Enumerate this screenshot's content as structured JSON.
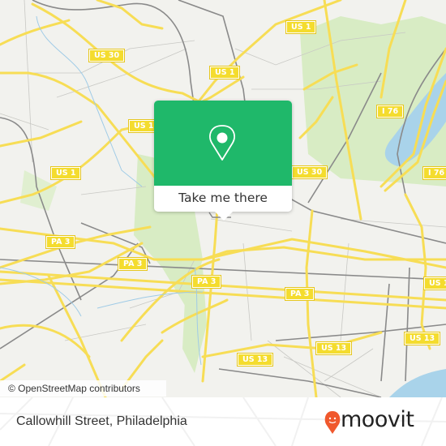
{
  "map": {
    "attribution": "© OpenStreetMap contributors",
    "route_shields": [
      {
        "label": "US 1",
        "id": "us1-top"
      },
      {
        "label": "US 30",
        "id": "us30-nw"
      },
      {
        "label": "US 1",
        "id": "us1-center"
      },
      {
        "label": "US 1",
        "id": "us1-mid"
      },
      {
        "label": "US 1",
        "id": "us1-west"
      },
      {
        "label": "US 30",
        "id": "us30-east"
      },
      {
        "label": "I 76",
        "id": "i76-north"
      },
      {
        "label": "I 76",
        "id": "i76-east"
      },
      {
        "label": "PA 3",
        "id": "pa3-west"
      },
      {
        "label": "PA 3",
        "id": "pa3-mid"
      },
      {
        "label": "PA 3",
        "id": "pa3-center"
      },
      {
        "label": "PA 3",
        "id": "pa3-east"
      },
      {
        "label": "US 1",
        "id": "us1-east-edge"
      },
      {
        "label": "US 13",
        "id": "us13-east"
      },
      {
        "label": "US 13",
        "id": "us13-center"
      },
      {
        "label": "US 13",
        "id": "us13-west"
      }
    ]
  },
  "popup": {
    "action_label": "Take me there",
    "icon": "map-pin-icon",
    "color": "#1fb86a"
  },
  "footer": {
    "place_name": "Callowhill Street, Philadelphia",
    "brand": "moovit",
    "brand_color": "#f0582d"
  }
}
